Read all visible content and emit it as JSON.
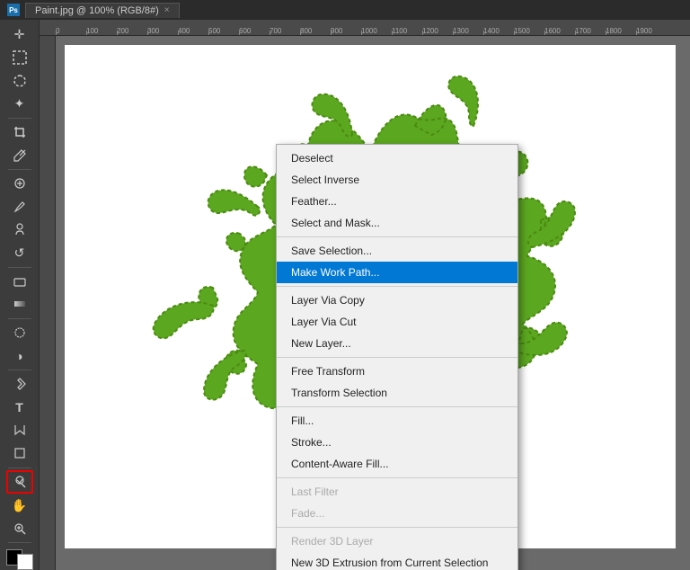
{
  "titleBar": {
    "appName": "Paint.jpg @ 100% (RGB/8#)",
    "tabLabel": "Paint.jpg @ 100% (RGB/8#)",
    "closeIcon": "×"
  },
  "toolbar": {
    "tools": [
      {
        "name": "move",
        "icon": "✛"
      },
      {
        "name": "rectangle-select",
        "icon": "⬚"
      },
      {
        "name": "lasso",
        "icon": "⌒"
      },
      {
        "name": "magic-wand",
        "icon": "✦"
      },
      {
        "name": "crop",
        "icon": "⬜"
      },
      {
        "name": "eyedropper",
        "icon": "⊘"
      },
      {
        "name": "spot-heal",
        "icon": "⊕"
      },
      {
        "name": "brush",
        "icon": "✏"
      },
      {
        "name": "clone",
        "icon": "⊗"
      },
      {
        "name": "history-brush",
        "icon": "↺"
      },
      {
        "name": "eraser",
        "icon": "◻"
      },
      {
        "name": "gradient",
        "icon": "▥"
      },
      {
        "name": "blur",
        "icon": "◌"
      },
      {
        "name": "dodge",
        "icon": "◑"
      },
      {
        "name": "pen",
        "icon": "✒"
      },
      {
        "name": "type",
        "icon": "T"
      },
      {
        "name": "path-select",
        "icon": "↖"
      },
      {
        "name": "shape",
        "icon": "◆"
      },
      {
        "name": "hand",
        "icon": "✋"
      },
      {
        "name": "zoom",
        "icon": "⊕"
      }
    ]
  },
  "contextMenu": {
    "items": [
      {
        "id": "deselect",
        "label": "Deselect",
        "state": "normal"
      },
      {
        "id": "select-inverse",
        "label": "Select Inverse",
        "state": "normal"
      },
      {
        "id": "feather",
        "label": "Feather...",
        "state": "normal"
      },
      {
        "id": "select-and-mask",
        "label": "Select and Mask...",
        "state": "normal"
      },
      {
        "id": "sep1",
        "type": "separator"
      },
      {
        "id": "save-selection",
        "label": "Save Selection...",
        "state": "normal"
      },
      {
        "id": "make-work-path",
        "label": "Make Work Path...",
        "state": "highlighted"
      },
      {
        "id": "sep2",
        "type": "separator"
      },
      {
        "id": "layer-via-copy",
        "label": "Layer Via Copy",
        "state": "normal"
      },
      {
        "id": "layer-via-cut",
        "label": "Layer Via Cut",
        "state": "normal"
      },
      {
        "id": "new-layer",
        "label": "New Layer...",
        "state": "normal"
      },
      {
        "id": "sep3",
        "type": "separator"
      },
      {
        "id": "free-transform",
        "label": "Free Transform",
        "state": "normal"
      },
      {
        "id": "transform-selection",
        "label": "Transform Selection",
        "state": "normal"
      },
      {
        "id": "sep4",
        "type": "separator"
      },
      {
        "id": "fill",
        "label": "Fill...",
        "state": "normal"
      },
      {
        "id": "stroke",
        "label": "Stroke...",
        "state": "normal"
      },
      {
        "id": "content-aware-fill",
        "label": "Content-Aware Fill...",
        "state": "normal"
      },
      {
        "id": "sep5",
        "type": "separator"
      },
      {
        "id": "last-filter",
        "label": "Last Filter",
        "state": "disabled"
      },
      {
        "id": "fade",
        "label": "Fade...",
        "state": "disabled"
      },
      {
        "id": "sep6",
        "type": "separator"
      },
      {
        "id": "render-3d-layer",
        "label": "Render 3D Layer",
        "state": "disabled"
      },
      {
        "id": "new-3d-extrusion",
        "label": "New 3D Extrusion from Current Selection",
        "state": "normal"
      }
    ]
  },
  "rulers": {
    "hTicks": [
      "0",
      "100",
      "200",
      "300",
      "400",
      "500",
      "600",
      "700",
      "800",
      "900",
      "1000",
      "1100",
      "1200",
      "1300",
      "1400",
      "1500",
      "1600",
      "1700",
      "1800",
      "1900"
    ]
  }
}
